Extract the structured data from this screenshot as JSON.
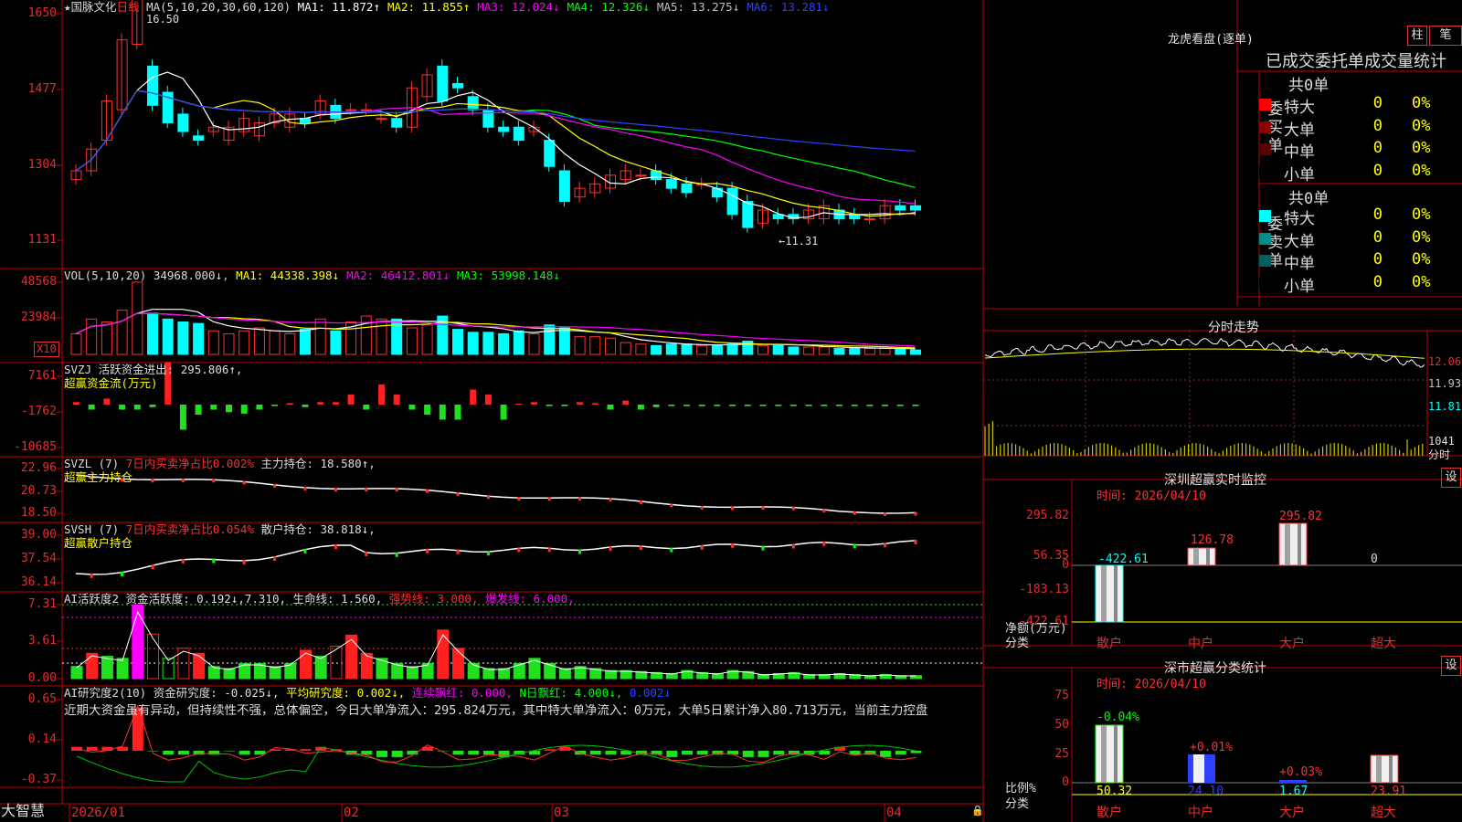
{
  "stock": {
    "star": "★",
    "name": "国脉文化",
    "period": "日线"
  },
  "price_panel": {
    "axis": [
      "1650",
      "1477",
      "1304",
      "1131"
    ],
    "ma_label": "MA(5,10,20,30,60,120)",
    "ma": [
      {
        "t": "MA1: 11.872↑",
        "c": "#ffffff"
      },
      {
        "t": "MA2: 11.855↑",
        "c": "#ffff00"
      },
      {
        "t": "MA3: 12.024↓",
        "c": "#ff00ff"
      },
      {
        "t": "MA4: 12.326↓",
        "c": "#00ff00"
      },
      {
        "t": "MA5: 13.275↓",
        "c": "#c0c0c0"
      },
      {
        "t": "MA6: 13.281↓",
        "c": "#3040ff"
      }
    ],
    "high_mark": "16.50",
    "low_mark": "←11.31"
  },
  "vol_panel": {
    "axis": [
      "48568",
      "23984"
    ],
    "unit": "X10",
    "label": "VOL(5,10,20)",
    "value": "34968.000↓",
    "ma": [
      {
        "t": "MA1: 44338.398↓",
        "c": "#ffff00"
      },
      {
        "t": "MA2: 46412.801↓",
        "c": "#ff00ff"
      },
      {
        "t": "MA3: 53998.148↓",
        "c": "#00ff00"
      }
    ]
  },
  "svzj": {
    "axis": [
      "7161",
      "-1762",
      "-10685"
    ],
    "label": "SVZJ",
    "text": "活跃资金进出: 295.806↑,",
    "sub": "超赢资金流(万元)"
  },
  "svzl": {
    "axis": [
      "22.96",
      "20.73",
      "18.50"
    ],
    "label": "SVZL (7)",
    "red": "7日内买卖净占比0.002%",
    "text": "主力持仓: 18.580↑,",
    "sub": "超赢主力持仓"
  },
  "svsh": {
    "axis": [
      "39.00",
      "37.54",
      "36.14"
    ],
    "label": "SVSH (7)",
    "red": "7日内买卖净占比0.054%",
    "text": "散户持仓: 38.818↓,",
    "sub": "超赢散户持仓"
  },
  "ai1": {
    "axis": [
      "7.31",
      "3.61",
      "0.00"
    ],
    "label": "AI活跃度2",
    "a": "资金活跃度: 0.192↓,7.310,",
    "b": "生命线: 1.560,",
    "c": "强势线: 3.000,",
    "d": "爆发线: 6.000,"
  },
  "ai2": {
    "axis": [
      "0.65",
      "0.14",
      "-0.37"
    ],
    "label": "AI研究度2(10)",
    "a": "资金研究度: -0.025↓,",
    "b": "平均研究度: 0.002↓,",
    "c": "连续飘红: 0.000,",
    "d": "N日飘红: 4.000↓,",
    "e": "0.002↓",
    "text": "近期大资金虽有异动，但持续性不强，总体偏空，今日大单净流入：295.824万元，其中特大单净流入：0万元，大单5日累计净入80.713万元，当前主力控盘"
  },
  "xaxis": {
    "labels": [
      "2026/01",
      "02",
      "03",
      "04"
    ],
    "brand": "大智慧"
  },
  "dragon": {
    "title": "龙虎看盘(逐单)",
    "btn1": "柱",
    "btn2": "笔",
    "header": "已成交委托单成交量统计",
    "buy": {
      "side": "委买单",
      "total": "共0单",
      "rows": [
        {
          "n": "特大",
          "v": "0",
          "p": "0%",
          "c": "#ff0000"
        },
        {
          "n": "大单",
          "v": "0",
          "p": "0%",
          "c": "#8b0000"
        },
        {
          "n": "中单",
          "v": "0",
          "p": "0%",
          "c": "#5a0000"
        },
        {
          "n": "小单",
          "v": "0",
          "p": "0%",
          "c": "#000000"
        }
      ]
    },
    "sell": {
      "side": "委卖单",
      "total": "共0单",
      "rows": [
        {
          "n": "特大",
          "v": "0",
          "p": "0%",
          "c": "#00ffff"
        },
        {
          "n": "大单",
          "v": "0",
          "p": "0%",
          "c": "#008b8b"
        },
        {
          "n": "中单",
          "v": "0",
          "p": "0%",
          "c": "#006060"
        },
        {
          "n": "小单",
          "v": "0",
          "p": "0%",
          "c": "#000000"
        }
      ]
    }
  },
  "intraday": {
    "title": "分时走势",
    "axis": [
      "12.06",
      "11.93",
      "11.81"
    ],
    "vol": "1041",
    "vol_label": "分时"
  },
  "sz_monitor": {
    "title": "深圳超赢实时监控",
    "btn": "设",
    "time": "时间: 2026/04/10",
    "axis": [
      "295.82",
      "56.35",
      "0",
      "-183.13",
      "-422.61"
    ],
    "ylabel": "净额(万元)",
    "xlabel": "分类",
    "bars": [
      {
        "cat": "散户",
        "v": "-422.61"
      },
      {
        "cat": "中户",
        "v": "126.78"
      },
      {
        "cat": "大户",
        "v": "295.82"
      },
      {
        "cat": "超大",
        "v": "0"
      }
    ]
  },
  "sz_class": {
    "title": "深市超赢分类统计",
    "btn": "设",
    "time": "时间: 2026/04/10",
    "axis": [
      "75",
      "50",
      "25",
      "0"
    ],
    "ylabel": "比例%",
    "xlabel": "分类",
    "bars": [
      {
        "cat": "散户",
        "top": "-0.04%",
        "bottom": "50.32"
      },
      {
        "cat": "中户",
        "top": "+0.01%",
        "bottom": "24.10"
      },
      {
        "cat": "大户",
        "top": "+0.03%",
        "bottom": "1.67"
      },
      {
        "cat": "超大",
        "top": "",
        "bottom": "23.91"
      }
    ]
  },
  "chart_data": [
    {
      "type": "candlestick",
      "title": "国脉文化 日线",
      "ylim": [
        11.31,
        16.5
      ],
      "note": "daily OHLC estimated",
      "open": [
        12.7,
        12.9,
        13.6,
        14.3,
        15.8,
        15.3,
        14.7,
        14.2,
        13.7,
        13.8,
        13.6,
        13.8,
        13.7,
        14.0,
        13.9,
        14.1,
        14.2,
        14.4,
        14.3,
        14.3,
        14.1,
        14.1,
        13.9,
        14.6,
        15.3,
        14.9,
        14.6,
        14.3,
        13.9,
        13.9,
        13.8,
        13.6,
        12.9,
        12.3,
        12.4,
        12.5,
        12.7,
        12.8,
        12.9,
        12.7,
        12.6,
        12.6,
        12.5,
        12.5,
        12.2,
        11.7,
        11.9,
        11.9,
        11.8,
        11.8,
        12.0,
        11.9,
        11.8,
        11.8,
        12.1,
        12.1
      ],
      "close": [
        12.9,
        13.4,
        14.5,
        15.9,
        17.0,
        14.4,
        14.0,
        13.8,
        13.6,
        13.9,
        13.9,
        14.1,
        14.0,
        14.2,
        14.2,
        14.0,
        14.5,
        14.1,
        14.3,
        14.3,
        14.1,
        13.9,
        14.8,
        15.1,
        14.5,
        14.8,
        14.3,
        13.9,
        13.8,
        13.6,
        13.9,
        13.0,
        12.2,
        12.5,
        12.6,
        12.8,
        12.9,
        12.8,
        12.7,
        12.5,
        12.4,
        12.6,
        12.3,
        11.9,
        11.6,
        12.0,
        11.8,
        11.8,
        12.0,
        12.1,
        11.8,
        11.8,
        11.8,
        12.1,
        12.0,
        12.0
      ]
    },
    {
      "type": "bar",
      "title": "VOL",
      "series": [
        {
          "name": "VOL",
          "values": [
            14000,
            24000,
            22000,
            30000,
            49000,
            28000,
            24000,
            22000,
            21000,
            16000,
            14000,
            16000,
            18000,
            16000,
            14000,
            17000,
            24000,
            16000,
            22000,
            26000,
            24000,
            24000,
            18000,
            20000,
            26000,
            17000,
            15000,
            15000,
            14000,
            16000,
            14000,
            20000,
            18000,
            12000,
            12000,
            11000,
            8000,
            7000,
            6000,
            7000,
            7000,
            6000,
            6000,
            7000,
            9000,
            6000,
            6000,
            5000,
            5000,
            5000,
            4000,
            4000,
            4000,
            4000,
            4000,
            3000
          ]
        }
      ]
    }
  ]
}
